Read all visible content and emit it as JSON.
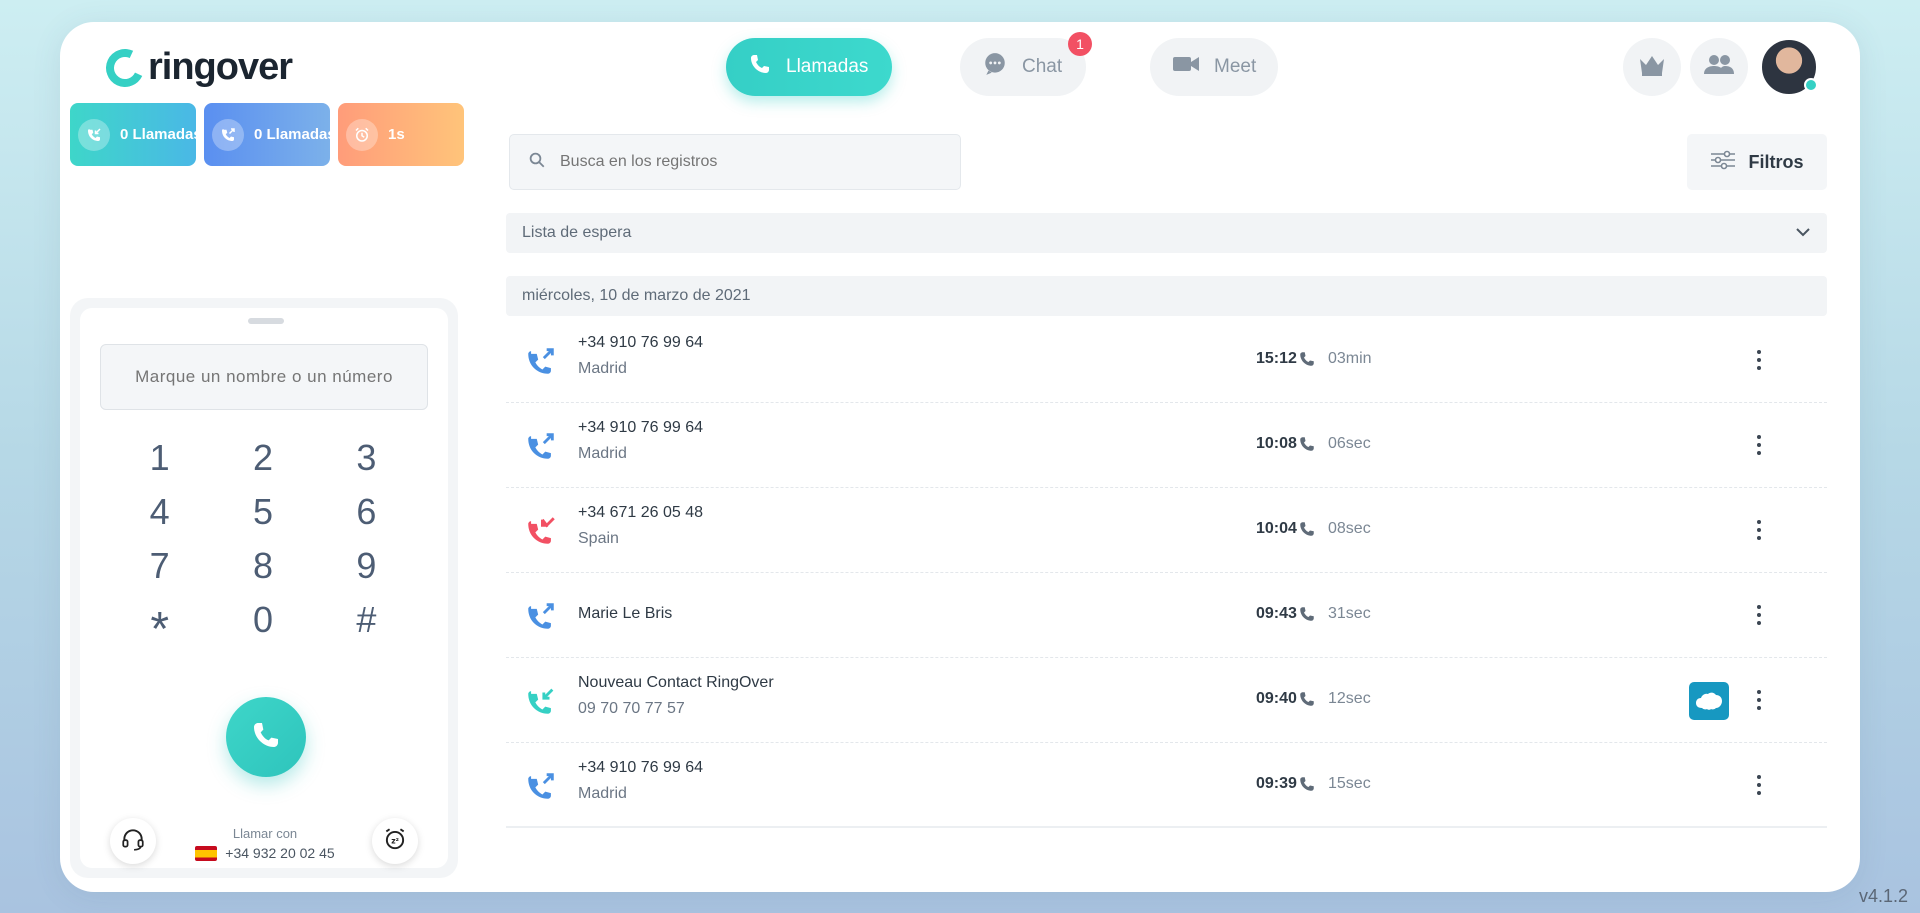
{
  "brand": {
    "name": "ringover"
  },
  "stats": [
    {
      "label": "0 Llamadas",
      "kind": "incoming",
      "icon": "incoming-call-icon"
    },
    {
      "label": "0 Llamadas",
      "kind": "outgoing",
      "icon": "outgoing-call-icon"
    },
    {
      "label": "1s",
      "kind": "time",
      "icon": "alarm-icon"
    }
  ],
  "nav": {
    "calls": "Llamadas",
    "chat": "Chat",
    "chat_badge": "1",
    "meet": "Meet"
  },
  "search": {
    "placeholder": "Busca en los registros"
  },
  "filters": {
    "label": "Filtros"
  },
  "waitlist": {
    "label": "Lista de espera"
  },
  "dialer": {
    "placeholder": "Marque un nombre o un número",
    "keys": [
      "1",
      "2",
      "3",
      "4",
      "5",
      "6",
      "7",
      "8",
      "9",
      "*",
      "0",
      "#"
    ],
    "call_with_label": "Llamar con",
    "call_with_number": "+34 932 20 02 45"
  },
  "log": {
    "date": "miércoles, 10 de marzo de 2021",
    "rows": [
      {
        "name": "+34 910 76 99 64",
        "sub": "Madrid",
        "time": "15:12",
        "duration": "03min",
        "direction": "outgoing"
      },
      {
        "name": "+34 910 76 99 64",
        "sub": "Madrid",
        "time": "10:08",
        "duration": "06sec",
        "direction": "outgoing"
      },
      {
        "name": "+34 671 26 05 48",
        "sub": "Spain",
        "time": "10:04",
        "duration": "08sec",
        "direction": "missed"
      },
      {
        "name": "Marie Le Bris",
        "sub": "",
        "time": "09:43",
        "duration": "31sec",
        "direction": "outgoing"
      },
      {
        "name": "Nouveau Contact RingOver",
        "sub": "09 70 70 77 57",
        "time": "09:40",
        "duration": "12sec",
        "direction": "incoming",
        "integration": "salesforce"
      },
      {
        "name": "+34 910 76 99 64",
        "sub": "Madrid",
        "time": "09:39",
        "duration": "15sec",
        "direction": "outgoing"
      }
    ]
  },
  "version": "v4.1.2",
  "colors": {
    "accent": "#35d0c4",
    "missed": "#f25063",
    "outgoing": "#4a90e2"
  }
}
